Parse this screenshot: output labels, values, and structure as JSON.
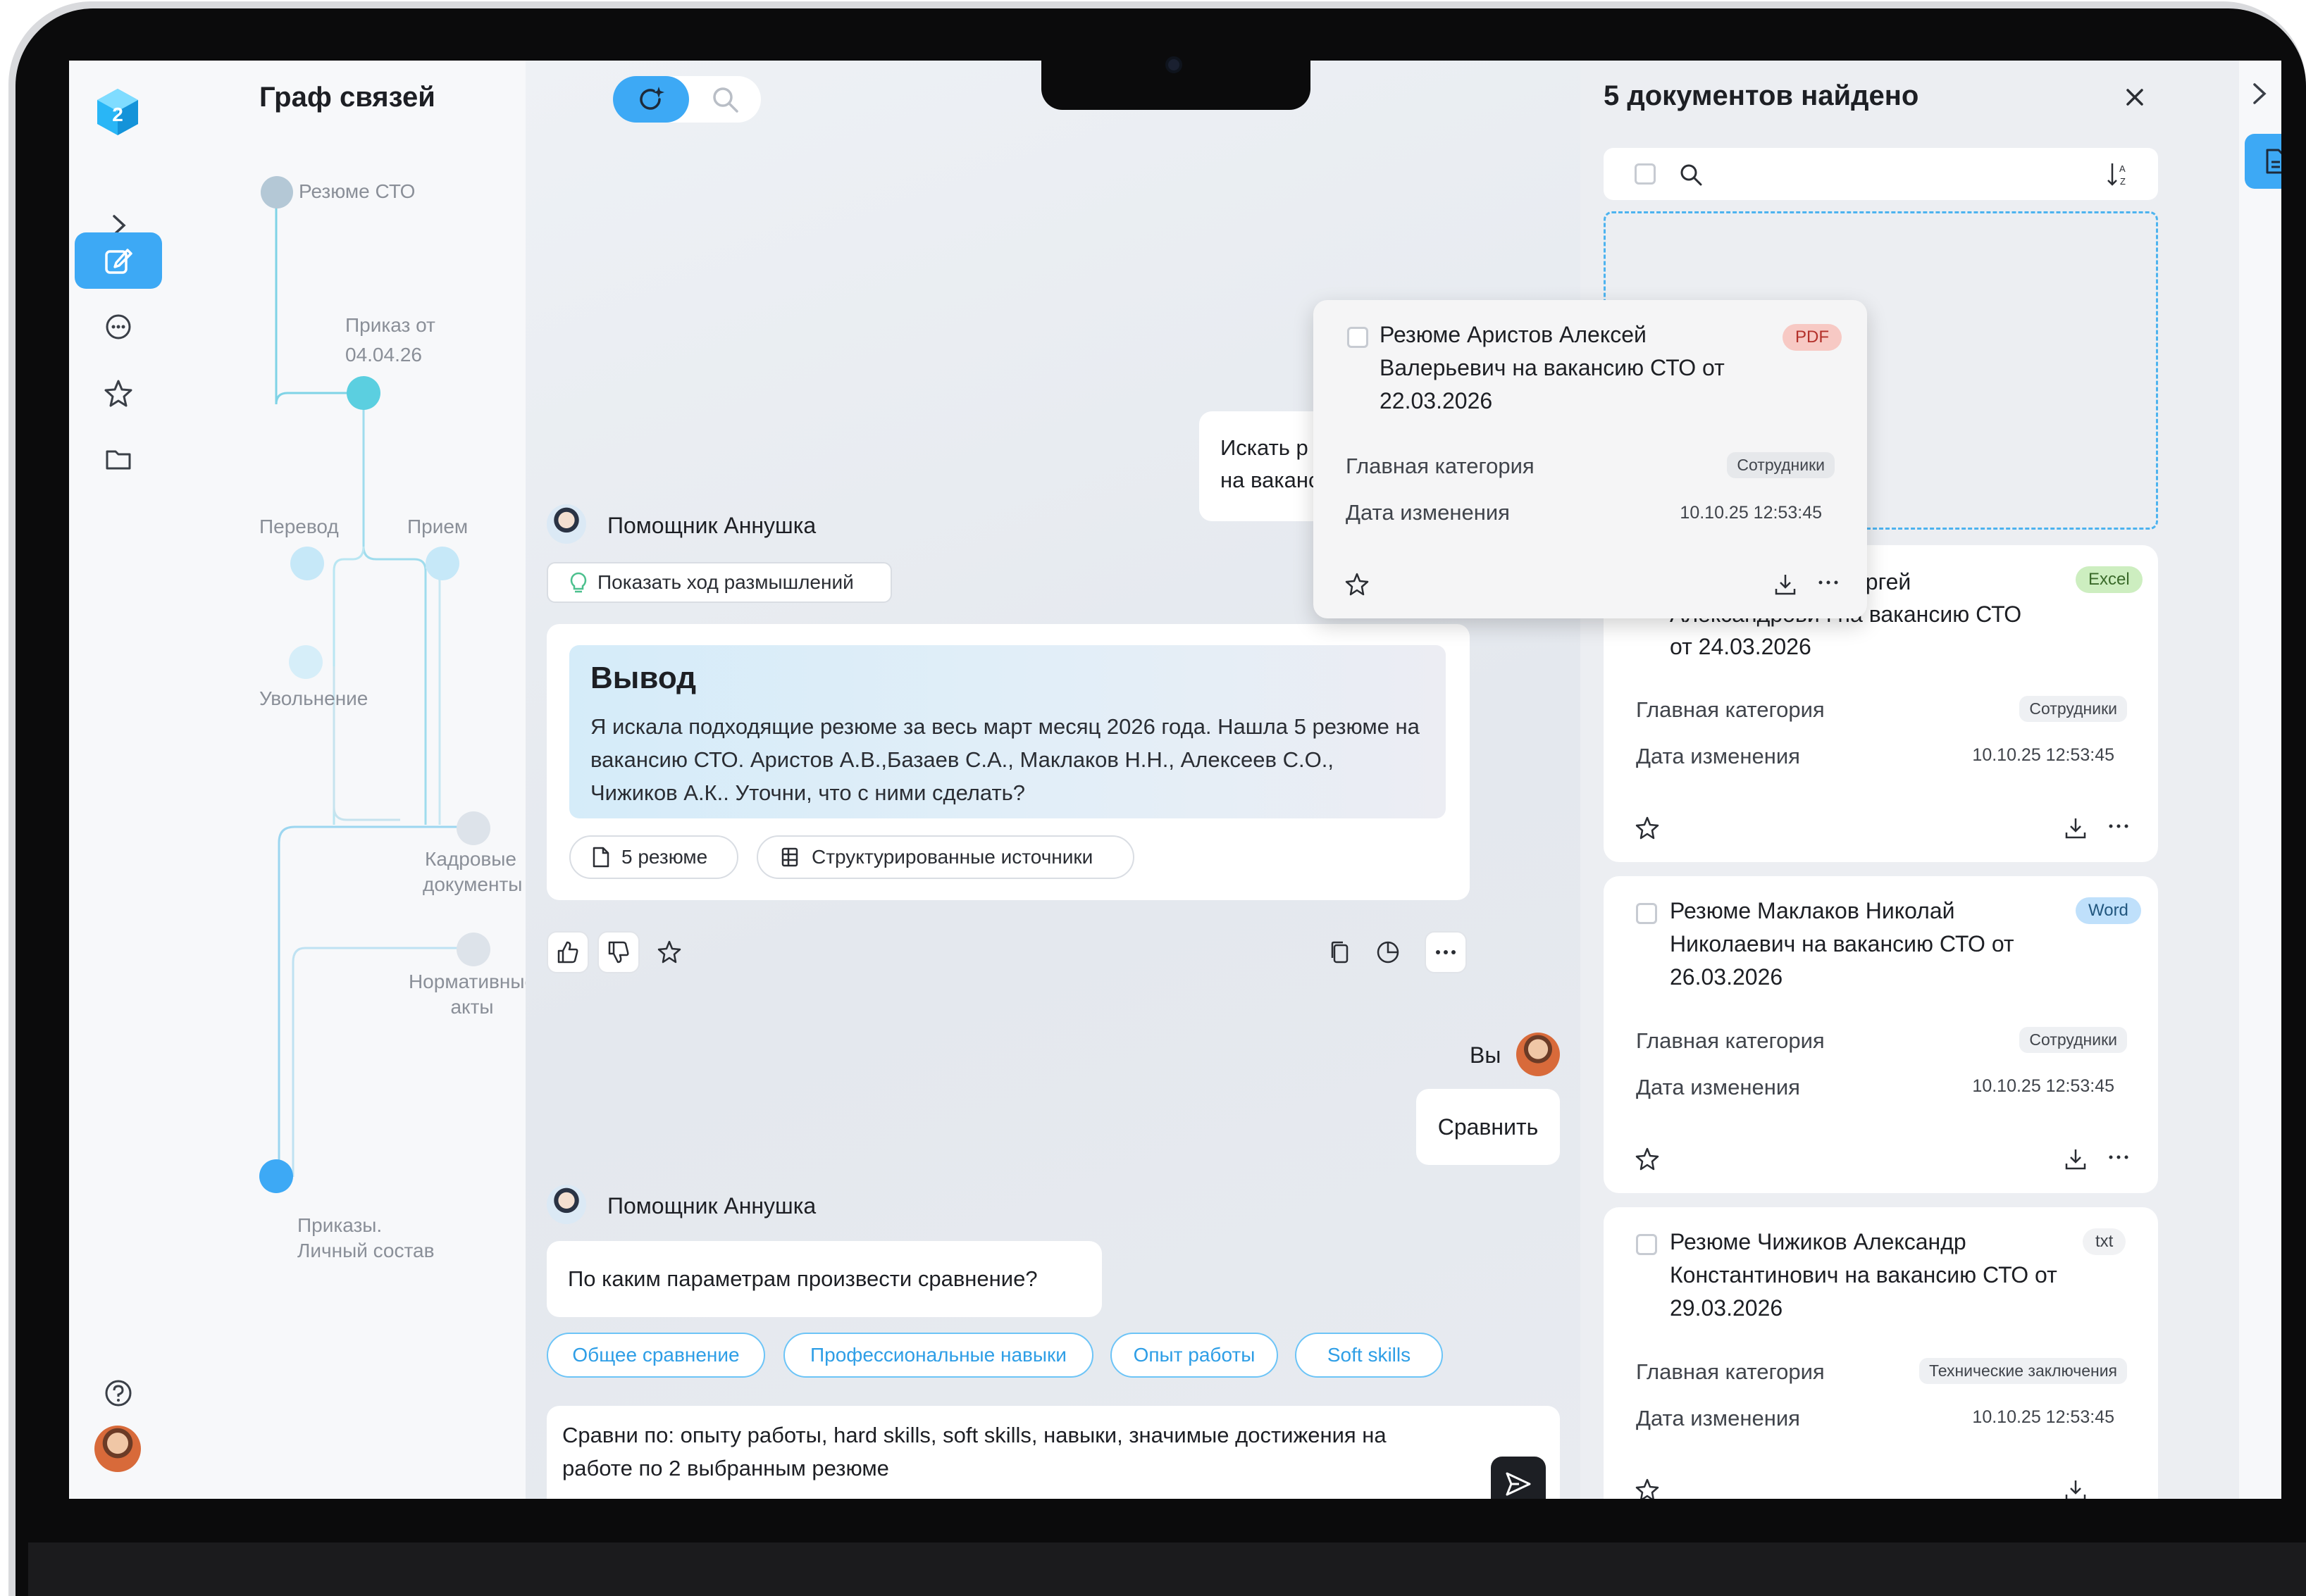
{
  "graph": {
    "title": "Граф связей",
    "nodes": {
      "resume": "Резюме СТО",
      "order_line1": "Приказ от",
      "order_line2": "04.04.26",
      "transfer": "Перевод",
      "hire": "Прием",
      "dismissal": "Увольнение",
      "hr_line1": "Кадровые",
      "hr_line2": "документы",
      "norm_line1": "Нормативные",
      "norm_line2": "акты",
      "orders_line1": "Приказы.",
      "orders_line2": "Личный состав"
    }
  },
  "chat": {
    "assistant_name": "Помощник Аннушка",
    "show_thinking": "Показать ход размышлений",
    "conclusion_title": "Вывод",
    "conclusion_text": "Я искала подходящие резюме за весь март месяц 2026 года. Нашла 5 резюме на вакансию СТО. Аристов А.В.,Базаев С.А., Маклаков Н.Н., Алексеев С.О., Чижиков А.К.. Уточни, что с ними сделать?",
    "resume_count_button": "5 резюме",
    "sources_button": "Структурированные источники",
    "hidden_user_line1": "Искать р",
    "hidden_user_line2": "на ваканс",
    "user_name": "Вы",
    "user_message": "Сравнить",
    "assistant_question": "По каким параметрам произвести сравнение?",
    "chips": [
      "Общее сравнение",
      "Профессиональные навыки",
      "Опыт работы",
      "Soft skills"
    ],
    "input_text": "Сравни по: опыту работы, hard skills, soft skills, навыки, значимые достижения на работе по 2 выбранным резюме"
  },
  "docs": {
    "title": "5 документов найдено",
    "meta_category_label": "Главная категория",
    "meta_date_label": "Дата изменения",
    "items": [
      {
        "title": "Резюме Аристов Алексей Валерьевич на вакансию СТО от 22.03.2026",
        "type": "PDF",
        "category": "Сотрудники",
        "date": "10.10.25 12:53:45"
      },
      {
        "title_visible": "ергей",
        "title_line2": "Александрович на вакансию СТО",
        "title_line3": "от 24.03.2026",
        "type": "Excel",
        "category": "Сотрудники",
        "date": "10.10.25 12:53:45"
      },
      {
        "title": "Резюме Маклаков Николай Николаевич на вакансию СТО от 26.03.2026",
        "type": "Word",
        "category": "Сотрудники",
        "date": "10.10.25 12:53:45"
      },
      {
        "title": "Резюме Чижиков Александр Константинович на вакансию СТО от 29.03.2026",
        "type": "txt",
        "category": "Технические заключения",
        "date": "10.10.25 12:53:45"
      }
    ]
  },
  "colors": {
    "accent": "#3da9f5",
    "graph_line": "#7fd3e6",
    "pdf_tag": "#f7c9c4",
    "excel_tag": "#cdeec0",
    "word_tag": "#bfe0fb"
  }
}
